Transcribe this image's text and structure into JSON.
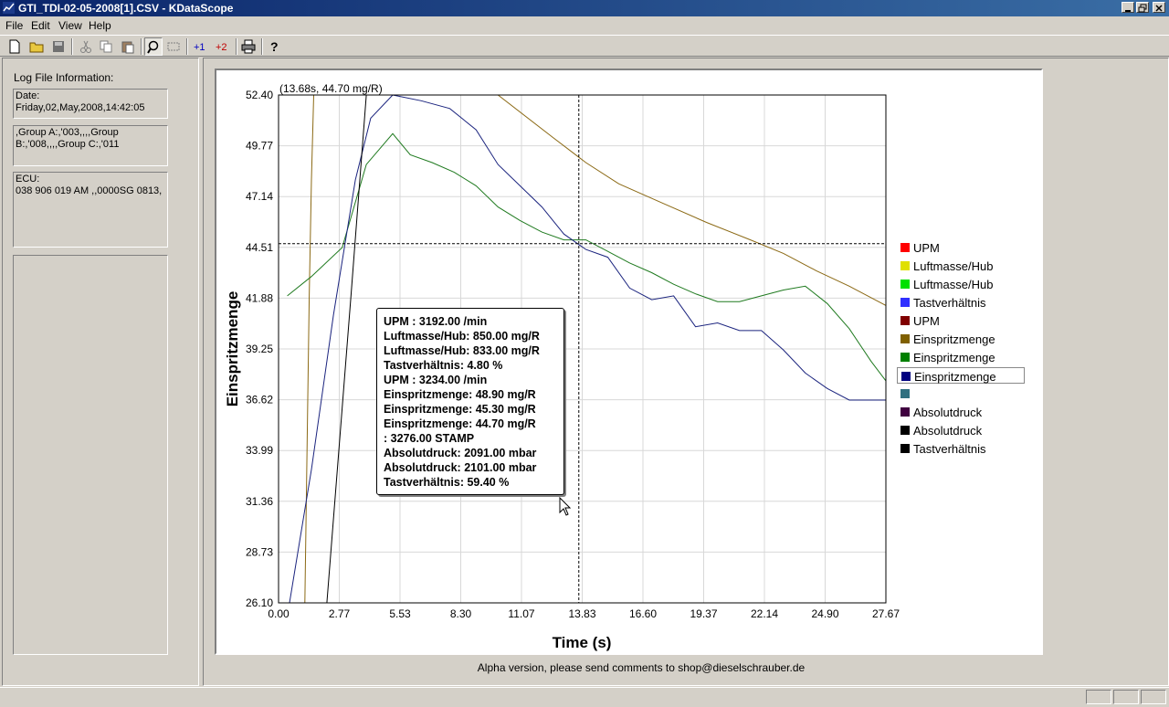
{
  "window": {
    "title": "GTI_TDI-02-05-2008[1].CSV - KDataScope",
    "icon": "app-chart-icon",
    "controls": [
      "minimize",
      "restore",
      "close"
    ]
  },
  "menu": [
    "File",
    "Edit",
    "View",
    "Help"
  ],
  "toolbar": [
    {
      "name": "new-icon"
    },
    {
      "name": "open-folder-icon"
    },
    {
      "name": "save-icon"
    },
    {
      "name": "cut-icon"
    },
    {
      "name": "copy-icon"
    },
    {
      "name": "paste-icon"
    },
    {
      "name": "zoom-icon",
      "pressed": true
    },
    {
      "name": "select-rect-icon"
    },
    {
      "name": "add-series-1-icon",
      "label": "+1"
    },
    {
      "name": "add-series-2-icon",
      "label": "+2"
    },
    {
      "name": "print-icon"
    },
    {
      "name": "help-icon"
    }
  ],
  "log_info": {
    "heading": "Log File Information:",
    "date_label": "Date:",
    "date_value": "Friday,02,May,2008,14:42:05",
    "groups_line1": ",Group A:,'003,,,,Group",
    "groups_line2": "B:,'008,,,,Group C:,'011",
    "ecu_label": "ECU:",
    "ecu_value": "038 906 019 AM  ,,0000SG  0813,"
  },
  "cursor_readout": "(13.68s, 44.70 mg/R)",
  "tooltip": [
    "UPM : 3192.00  /min",
    "Luftmasse/Hub: 850.00  mg/R",
    "Luftmasse/Hub: 833.00  mg/R",
    "Tastverhältnis: 4.80  %",
    "UPM : 3234.00  /min",
    "Einspritzmenge: 48.90  mg/R",
    "Einspritzmenge: 45.30  mg/R",
    "Einspritzmenge: 44.70  mg/R",
    ": 3276.00 STAMP",
    "Absolutdruck: 2091.00  mbar",
    "Absolutdruck: 2101.00  mbar",
    "Tastverhältnis: 59.40  %"
  ],
  "legend": [
    {
      "label": "UPM",
      "color": "#ff0000"
    },
    {
      "label": "Luftmasse/Hub",
      "color": "#e0e000"
    },
    {
      "label": "Luftmasse/Hub",
      "color": "#00e000"
    },
    {
      "label": "Tastverhältnis",
      "color": "#3030ff"
    },
    {
      "label": "UPM",
      "color": "#800000"
    },
    {
      "label": "Einspritzmenge",
      "color": "#806000"
    },
    {
      "label": "Einspritzmenge",
      "color": "#008000"
    },
    {
      "label": "Einspritzmenge",
      "color": "#000080",
      "selected": true
    },
    {
      "label": "",
      "color": "#307080"
    },
    {
      "label": "Absolutdruck",
      "color": "#400040"
    },
    {
      "label": "Absolutdruck",
      "color": "#000000"
    },
    {
      "label": "Tastverhältnis",
      "color": "#000000"
    }
  ],
  "footer_text": "Alpha version, please send comments to shop@dieselschrauber.de",
  "chart_data": {
    "type": "line",
    "xlabel": "Time (s)",
    "ylabel": "Einspritzmenge",
    "xlim": [
      0.0,
      27.67
    ],
    "ylim": [
      26.1,
      52.4
    ],
    "x_ticks": [
      "0.00",
      "2.77",
      "5.53",
      "8.30",
      "11.07",
      "13.83",
      "16.60",
      "19.37",
      "22.14",
      "24.90",
      "27.67"
    ],
    "y_ticks": [
      "52.40",
      "49.77",
      "47.14",
      "44.51",
      "41.88",
      "39.25",
      "36.62",
      "33.99",
      "31.36",
      "28.73",
      "26.10"
    ],
    "grid": true,
    "crosshair": {
      "x": 13.68,
      "y": 44.7
    },
    "series": [
      {
        "color": "#8b6914",
        "points": [
          [
            1.2,
            26.1
          ],
          [
            1.4,
            42
          ],
          [
            1.5,
            48
          ],
          [
            1.6,
            52.4
          ]
        ]
      },
      {
        "color": "#8b6914",
        "points": [
          [
            10.0,
            52.4
          ],
          [
            12.5,
            50.2
          ],
          [
            14.0,
            48.9
          ],
          [
            15.5,
            47.8
          ],
          [
            17.5,
            46.8
          ],
          [
            19.5,
            45.8
          ],
          [
            21.5,
            44.9
          ],
          [
            23.0,
            44.2
          ],
          [
            24.5,
            43.3
          ],
          [
            26.0,
            42.5
          ],
          [
            27.67,
            41.5
          ]
        ]
      },
      {
        "color": "#1f7a1f",
        "points": [
          [
            0.4,
            42.0
          ],
          [
            1.5,
            43.0
          ],
          [
            2.9,
            44.5
          ],
          [
            4.0,
            48.8
          ],
          [
            5.2,
            50.4
          ],
          [
            6.0,
            49.3
          ],
          [
            7.0,
            48.9
          ],
          [
            8.0,
            48.4
          ],
          [
            9.0,
            47.7
          ],
          [
            10.0,
            46.6
          ],
          [
            11.0,
            45.9
          ],
          [
            12.0,
            45.3
          ],
          [
            13.0,
            44.9
          ],
          [
            14.0,
            44.9
          ],
          [
            15.0,
            44.3
          ],
          [
            16.0,
            43.7
          ],
          [
            17.0,
            43.2
          ],
          [
            18.0,
            42.6
          ],
          [
            19.0,
            42.1
          ],
          [
            20.0,
            41.7
          ],
          [
            21.0,
            41.7
          ],
          [
            22.0,
            42.0
          ],
          [
            23.0,
            42.3
          ],
          [
            24.0,
            42.5
          ],
          [
            25.0,
            41.6
          ],
          [
            26.0,
            40.3
          ],
          [
            27.0,
            38.6
          ],
          [
            27.67,
            37.6
          ]
        ]
      },
      {
        "color": "#1a237e",
        "points": [
          [
            0.5,
            26.1
          ],
          [
            1.5,
            33.0
          ],
          [
            2.5,
            41.0
          ],
          [
            3.5,
            48.0
          ],
          [
            4.2,
            51.2
          ],
          [
            5.2,
            52.4
          ],
          [
            6.5,
            52.1
          ],
          [
            7.8,
            51.7
          ],
          [
            9.0,
            50.6
          ],
          [
            10.0,
            48.8
          ],
          [
            11.0,
            47.7
          ],
          [
            12.0,
            46.6
          ],
          [
            13.0,
            45.2
          ],
          [
            14.0,
            44.4
          ],
          [
            15.0,
            44.0
          ],
          [
            16.0,
            42.4
          ],
          [
            17.0,
            41.8
          ],
          [
            18.0,
            42.0
          ],
          [
            19.0,
            40.4
          ],
          [
            20.0,
            40.6
          ],
          [
            21.0,
            40.2
          ],
          [
            22.0,
            40.2
          ],
          [
            23.0,
            39.2
          ],
          [
            24.0,
            38.0
          ],
          [
            25.0,
            37.2
          ],
          [
            26.0,
            36.6
          ],
          [
            27.0,
            36.6
          ],
          [
            27.67,
            36.6
          ]
        ]
      },
      {
        "color": "#000000",
        "points": [
          [
            2.2,
            26.1
          ],
          [
            3.3,
            42.0
          ],
          [
            4.0,
            52.4
          ]
        ]
      }
    ]
  }
}
